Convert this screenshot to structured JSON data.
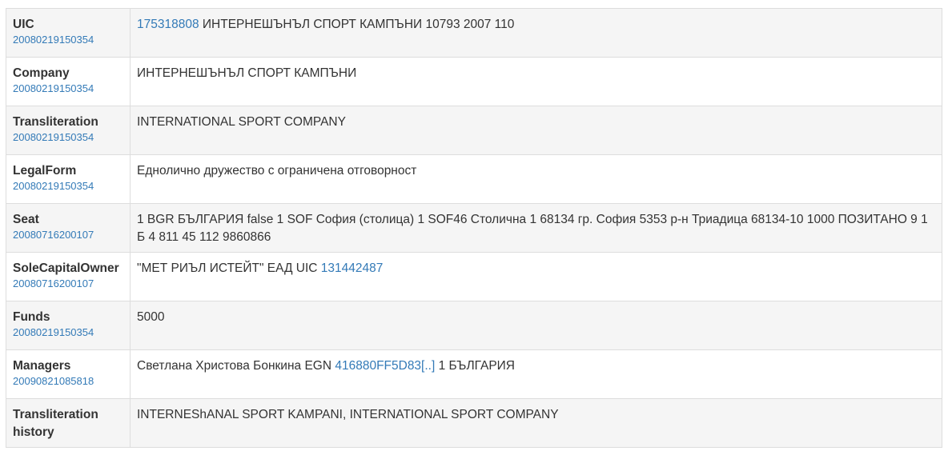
{
  "rows": [
    {
      "key": "UIC",
      "date": "20080219150354",
      "link1": "175318808",
      "text1": " ИНТЕРНЕШЪНЪЛ СПОРТ КАМПЪНИ 10793 2007 110"
    },
    {
      "key": "Company",
      "date": "20080219150354",
      "text1": "ИНТЕРНЕШЪНЪЛ СПОРТ КАМПЪНИ"
    },
    {
      "key": "Transliteration",
      "date": "20080219150354",
      "text1": "INTERNATIONAL SPORT COMPANY"
    },
    {
      "key": "LegalForm",
      "date": "20080219150354",
      "text1": "Еднолично дружество с ограничена отговорност"
    },
    {
      "key": "Seat",
      "date": "20080716200107",
      "text1": "1 BGR БЪЛГАРИЯ false 1 SOF София (столица) 1 SOF46 Столична 1 68134 гр. София 5353 р-н Триадица 68134-10 1000 ПОЗИТАНО 9 1 Б 4 811 45 112 9860866"
    },
    {
      "key": "SoleCapitalOwner",
      "date": "20080716200107",
      "text1": "\"МЕТ РИЪЛ ИСТЕЙТ\" ЕАД UIC ",
      "link1": "131442487"
    },
    {
      "key": "Funds",
      "date": "20080219150354",
      "text1": "5000"
    },
    {
      "key": "Managers",
      "date": "20090821085818",
      "text1": "Светлана Христова Бонкина EGN ",
      "link1": "416880FF5D83[..]",
      "text2": " 1 БЪЛГАРИЯ"
    },
    {
      "key": "Transliteration history",
      "text1": "INTERNEShANAL SPORT KAMPANI, INTERNATIONAL SPORT COMPANY"
    }
  ]
}
